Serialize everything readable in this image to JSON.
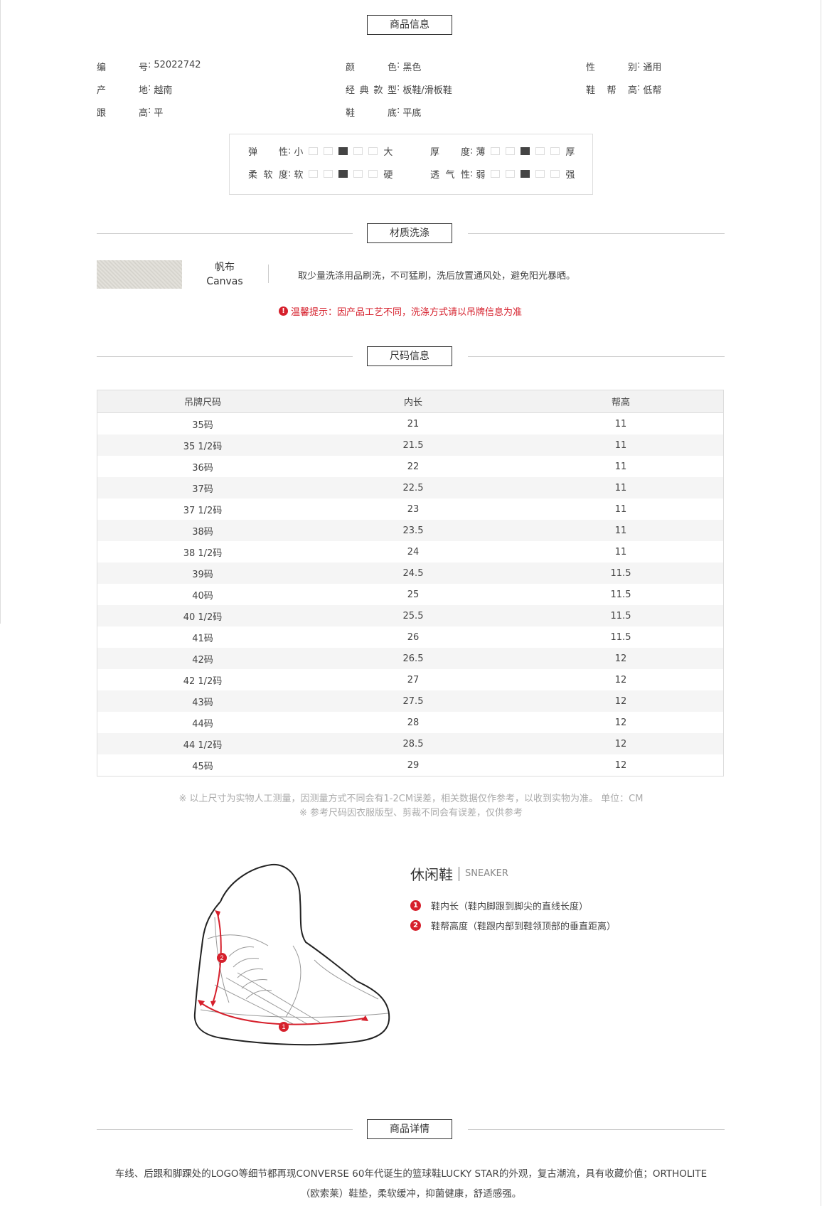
{
  "sections": {
    "info": "商品信息",
    "material": "材质洗涤",
    "size": "尺码信息",
    "details": "商品详情"
  },
  "attrs": [
    {
      "k": "编号",
      "v": "52022742"
    },
    {
      "k": "颜色",
      "v": "黑色"
    },
    {
      "k": "性别",
      "v": "通用"
    },
    {
      "k": "产地",
      "v": "越南"
    },
    {
      "k": "经典款型",
      "v": "板鞋/滑板鞋"
    },
    {
      "k": "鞋帮高",
      "v": "低帮"
    },
    {
      "k": "跟高",
      "v": "平"
    },
    {
      "k": "鞋底",
      "v": "平底"
    }
  ],
  "specs": [
    {
      "label": "弹性",
      "low": "小",
      "high": "大",
      "level": 3
    },
    {
      "label": "厚度",
      "low": "薄",
      "high": "厚",
      "level": 3
    },
    {
      "label": "柔软度",
      "low": "软",
      "high": "硬",
      "level": 3
    },
    {
      "label": "透气性",
      "low": "弱",
      "high": "强",
      "level": 3
    }
  ],
  "material": {
    "name_cn": "帆布",
    "name_en": "Canvas",
    "care": "取少量洗涤用品刷洗，不可猛刷，洗后放置通风处，避免阳光暴晒。",
    "warning": "温馨提示：因产品工艺不同，洗涤方式请以吊牌信息为准"
  },
  "size_table": {
    "headers": [
      "吊牌尺码",
      "内长",
      "帮高"
    ],
    "rows": [
      [
        "35码",
        "21",
        "11"
      ],
      [
        "35 1/2码",
        "21.5",
        "11"
      ],
      [
        "36码",
        "22",
        "11"
      ],
      [
        "37码",
        "22.5",
        "11"
      ],
      [
        "37 1/2码",
        "23",
        "11"
      ],
      [
        "38码",
        "23.5",
        "11"
      ],
      [
        "38 1/2码",
        "24",
        "11"
      ],
      [
        "39码",
        "24.5",
        "11.5"
      ],
      [
        "40码",
        "25",
        "11.5"
      ],
      [
        "40 1/2码",
        "25.5",
        "11.5"
      ],
      [
        "41码",
        "26",
        "11.5"
      ],
      [
        "42码",
        "26.5",
        "12"
      ],
      [
        "42 1/2码",
        "27",
        "12"
      ],
      [
        "43码",
        "27.5",
        "12"
      ],
      [
        "44码",
        "28",
        "12"
      ],
      [
        "44 1/2码",
        "28.5",
        "12"
      ],
      [
        "45码",
        "29",
        "12"
      ]
    ]
  },
  "notes": {
    "line1": "※ 以上尺寸为实物人工测量，因测量方式不同会有1-2CM误差，相关数据仅作参考，以收到实物为准。 单位：CM",
    "line2": "※ 参考尺码因衣服版型、剪裁不同会有误差，仅供参考"
  },
  "shoe_type": {
    "cn": "休闲鞋",
    "en": "SNEAKER",
    "legend": [
      {
        "num": "1",
        "text": "鞋内长（鞋内脚跟到脚尖的直线长度）"
      },
      {
        "num": "2",
        "text": "鞋帮高度（鞋跟内部到鞋领顶部的垂直距离）"
      }
    ]
  },
  "details_text": "车线、后跟和脚踝处的LOGO等细节都再现CONVERSE 60年代诞生的篮球鞋LUCKY STAR的外观，复古潮流，具有收藏价值；ORTHOLITE（欧索莱）鞋垫，柔软缓冲，抑菌健康，舒适感强。",
  "colors": {
    "accent": "#d6202c",
    "border": "#dddddd",
    "row_alt": "#f5f5f5"
  }
}
